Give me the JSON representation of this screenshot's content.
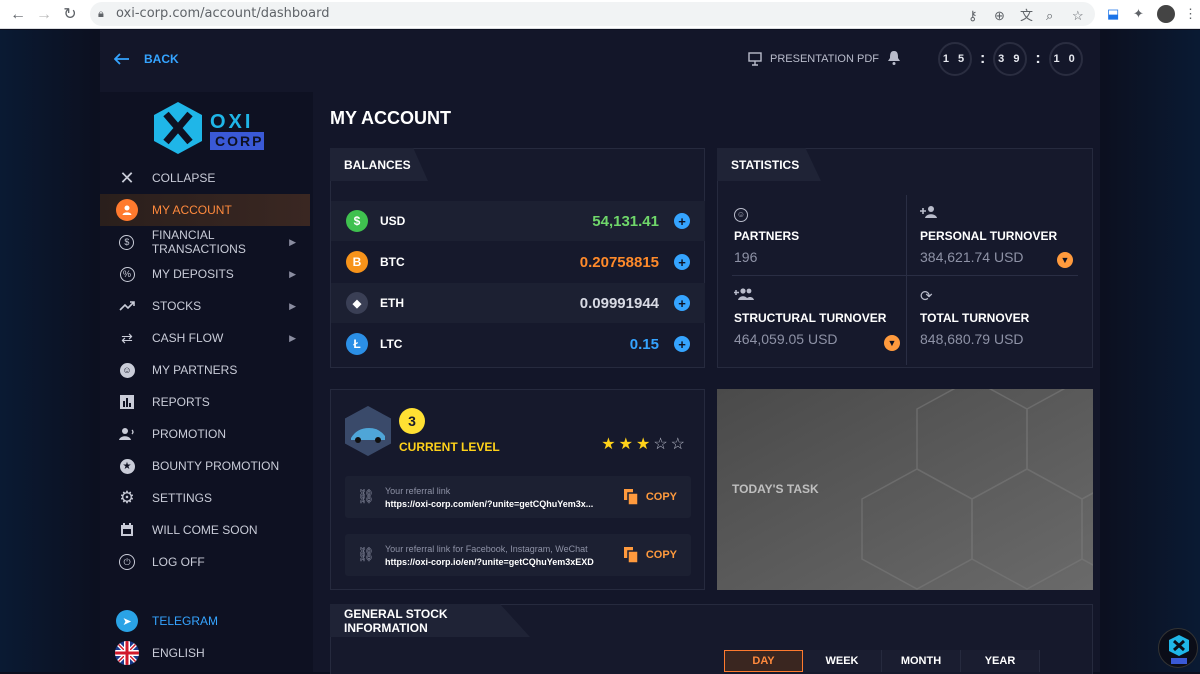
{
  "browser": {
    "url": "oxi-corp.com/account/dashboard"
  },
  "topbar": {
    "back_label": "BACK",
    "presentation_label": "PRESENTATION PDF",
    "timer": [
      "1 5",
      "3 9",
      "1 0"
    ]
  },
  "logo": {
    "line1": "OXI",
    "line2": "CORP"
  },
  "sidebar": {
    "items": [
      {
        "label": "COLLAPSE",
        "icon": "close-icon",
        "active": false
      },
      {
        "label": "MY ACCOUNT",
        "icon": "user-icon",
        "active": true
      },
      {
        "label": "FINANCIAL TRANSACTIONS",
        "icon": "dollar-icon",
        "active": false,
        "submenu": true
      },
      {
        "label": "MY DEPOSITS",
        "icon": "percent-icon",
        "active": false,
        "submenu": true
      },
      {
        "label": "STOCKS",
        "icon": "trend-icon",
        "active": false,
        "submenu": true
      },
      {
        "label": "CASH FLOW",
        "icon": "transfer-icon",
        "active": false,
        "submenu": true
      },
      {
        "label": "MY PARTNERS",
        "icon": "partners-icon",
        "active": false
      },
      {
        "label": "REPORTS",
        "icon": "bar-chart-icon",
        "active": false
      },
      {
        "label": "PROMOTION",
        "icon": "promotion-icon",
        "active": false
      },
      {
        "label": "BOUNTY PROMOTION",
        "icon": "star-icon",
        "active": false
      },
      {
        "label": "SETTINGS",
        "icon": "gear-icon",
        "active": false
      },
      {
        "label": "WILL COME SOON",
        "icon": "calendar-icon",
        "active": false
      },
      {
        "label": "LOG OFF",
        "icon": "power-icon",
        "active": false
      }
    ],
    "telegram_label": "TELEGRAM",
    "language_label": "ENGLISH"
  },
  "page": {
    "title": "MY ACCOUNT"
  },
  "balances": {
    "tab": "BALANCES",
    "rows": [
      {
        "name": "USD",
        "value": "54,131.41",
        "color": "#6fd66a",
        "icon_color": "#3fc14f",
        "glyph": "$"
      },
      {
        "name": "BTC",
        "value": "0.20758815",
        "color": "#ff8a2a",
        "icon_color": "#f7931a",
        "glyph": "B"
      },
      {
        "name": "ETH",
        "value": "0.09991944",
        "color": "#d8dae4",
        "icon_color": "#3a3f55",
        "glyph": "◆"
      },
      {
        "name": "LTC",
        "value": "0.15",
        "color": "#35a4ff",
        "icon_color": "#2b8fe6",
        "glyph": "Ł"
      }
    ]
  },
  "statistics": {
    "tab": "STATISTICS",
    "cells": [
      {
        "label": "PARTNERS",
        "value": "196"
      },
      {
        "label": "PERSONAL TURNOVER",
        "value": "384,621.74 USD"
      },
      {
        "label": "STRUCTURAL TURNOVER",
        "value": "464,059.05 USD"
      },
      {
        "label": "TOTAL TURNOVER",
        "value": "848,680.79 USD"
      }
    ]
  },
  "level": {
    "number": "3",
    "label": "CURRENT LEVEL",
    "stars_filled": 3,
    "stars_total": 5,
    "links": [
      {
        "label": "Your referral link",
        "url": "https://oxi-corp.com/en/?unite=getCQhuYem3x...",
        "copy": "COPY"
      },
      {
        "label": "Your referral link for Facebook, Instagram, WeChat",
        "url": "https://oxi-corp.io/en/?unite=getCQhuYem3xEXD",
        "copy": "COPY"
      }
    ]
  },
  "task": {
    "title": "TODAY'S TASK"
  },
  "stock": {
    "tab": "GENERAL STOCK INFORMATION",
    "periods": [
      "DAY",
      "WEEK",
      "MONTH",
      "YEAR"
    ],
    "active_period": "DAY"
  },
  "colors": {
    "accent_orange": "#ff7a2e",
    "accent_blue": "#35a4ff",
    "star_yellow": "#ffd21a"
  }
}
